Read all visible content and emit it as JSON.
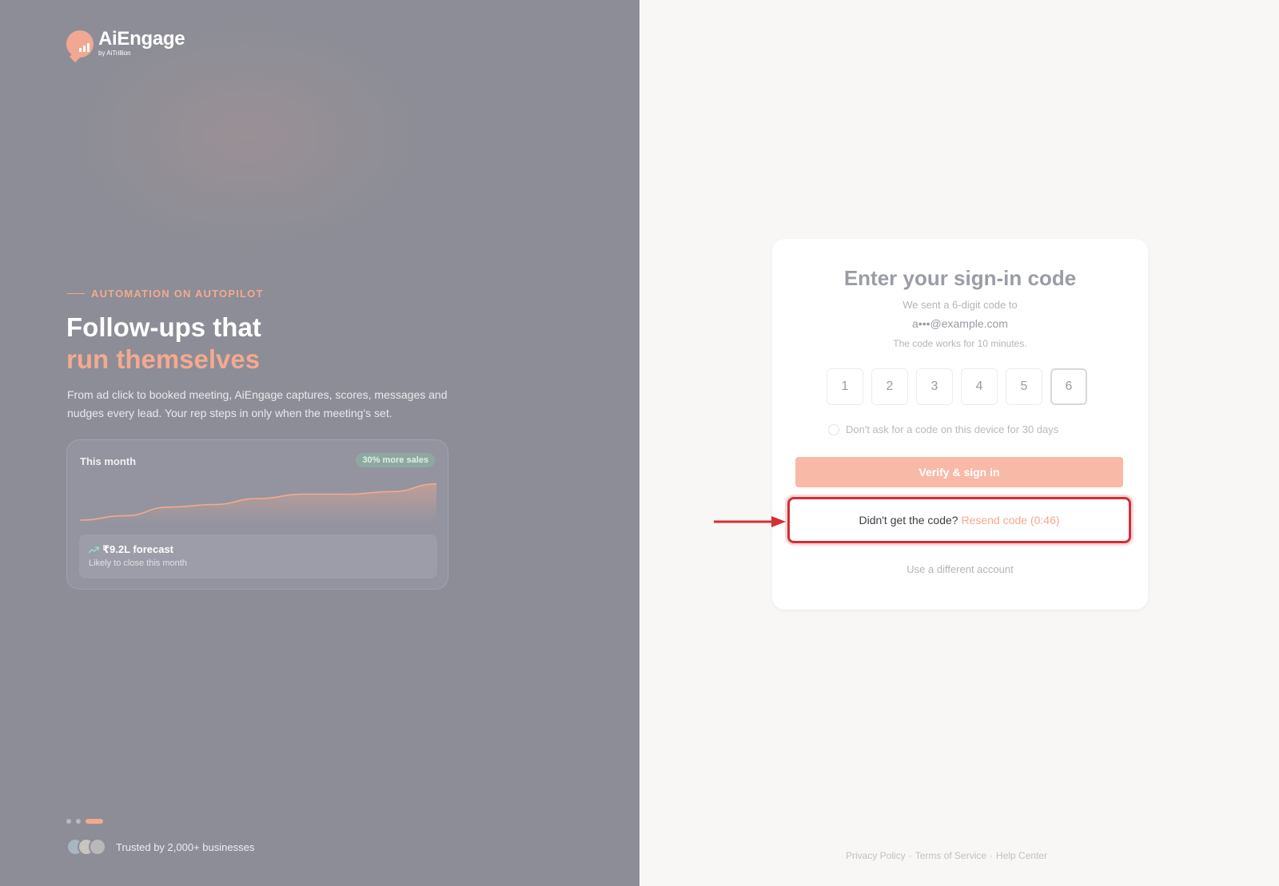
{
  "brand": {
    "name": "AiEngage",
    "by": "by AiTrillion",
    "accent": "#f4a98e"
  },
  "hero": {
    "eyebrow": "AUTOMATION ON AUTOPILOT",
    "headline_line1": "Follow-ups that",
    "headline_line2": "run themselves",
    "description": "From ad click to booked meeting, AiEngage captures, scores, messages and nudges every lead. Your rep steps in only when the meeting's set."
  },
  "stats_card": {
    "title": "This month",
    "badge": "30% more sales",
    "forecast_value": "₹9.2L forecast",
    "forecast_sub": "Likely to close this month",
    "trend_icon": "trending-up-icon"
  },
  "chart_data": {
    "type": "area",
    "x": [
      0,
      1,
      2,
      3,
      4,
      5,
      6,
      7,
      8
    ],
    "values": [
      0,
      5,
      15,
      18,
      25,
      30,
      30,
      33,
      42
    ],
    "title": "",
    "xlabel": "",
    "ylabel": "",
    "ylim": [
      0,
      50
    ],
    "grid": false
  },
  "carousel": {
    "count": 3,
    "active_index": 2
  },
  "trusted": {
    "text": "Trusted by 2,000+ businesses"
  },
  "signin": {
    "title": "Enter your sign-in code",
    "sent_text": "We sent a 6-digit code to",
    "email": "a•••@example.com",
    "works_text": "The code works for 10 minutes.",
    "digits": [
      "1",
      "2",
      "3",
      "4",
      "5",
      "6"
    ],
    "remember_label": "Don't ask for a code on this device for 30 days",
    "verify_label": "Verify & sign in",
    "resend_prompt": "Didn't get the code?",
    "resend_link": "Resend code (0:46)",
    "different_account": "Use a different account"
  },
  "footer": {
    "privacy": "Privacy Policy",
    "terms": "Terms of Service",
    "help": "Help Center",
    "separator": "·"
  },
  "colors": {
    "left_bg": "#8c8d96",
    "highlight": "#d42e35",
    "button": "#f8b9a7"
  }
}
